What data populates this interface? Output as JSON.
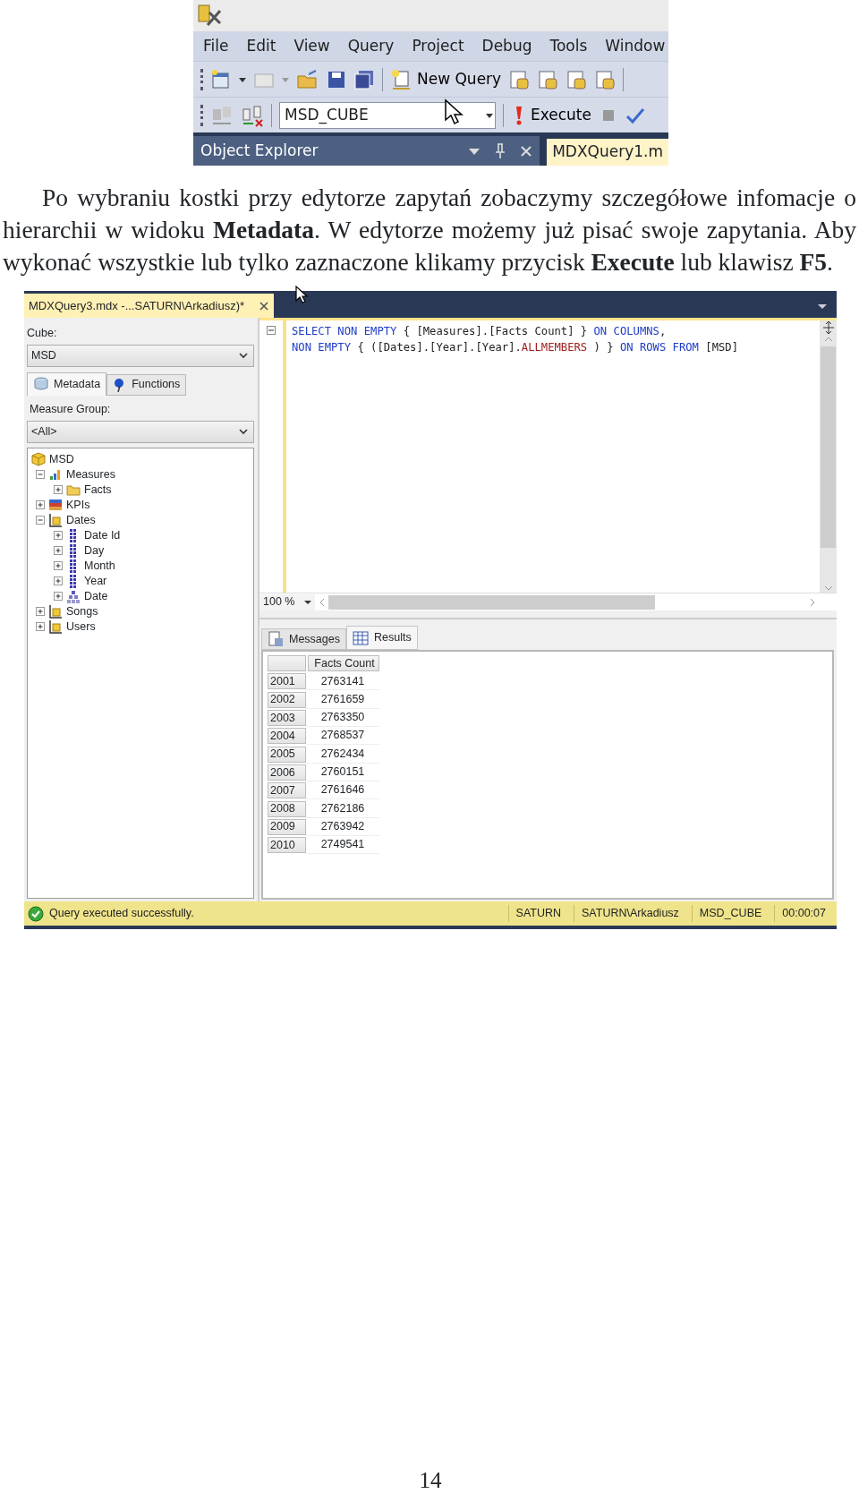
{
  "toolbar_screenshot": {
    "menu": [
      "File",
      "Edit",
      "View",
      "Query",
      "Project",
      "Debug",
      "Tools",
      "Window"
    ],
    "new_query": "New Query",
    "database": {
      "value": "MSD_CUBE"
    },
    "execute": "Execute",
    "panel_title": "Object Explorer",
    "document_tab": "MDXQuery1.m"
  },
  "paragraph": "Po wybraniu kostki przy edytorze zapytań zobaczymy szczegółowe infomacje o hierarchii w widoku **Metadata**. W edytorze możemy już pisać swoje zapytania. Aby wykonać wszystkie lub tylko zaznaczone klikamy przycisk **Execute** lub klawisz **F5**.",
  "query_screenshot": {
    "document_tab": "MDXQuery3.mdx -...SATURN\\Arkadiusz)*",
    "cube_label": "Cube:",
    "cube": "MSD",
    "tabs": [
      {
        "label": "Metadata",
        "selected": true
      },
      {
        "label": "Functions",
        "selected": false
      }
    ],
    "measure_group_label": "Measure Group:",
    "measure_group": "<All>",
    "tree": [
      {
        "label": "MSD",
        "kind": "cube",
        "children": [
          {
            "label": "Measures",
            "kind": "measures",
            "expanded": true,
            "children": [
              {
                "label": "Facts",
                "kind": "folder",
                "expanded": false
              }
            ]
          },
          {
            "label": "KPIs",
            "kind": "kpi",
            "expanded": false
          },
          {
            "label": "Dates",
            "kind": "dimension",
            "expanded": true,
            "children": [
              {
                "label": "Date Id",
                "kind": "attribute",
                "expanded": false
              },
              {
                "label": "Day",
                "kind": "attribute",
                "expanded": false
              },
              {
                "label": "Month",
                "kind": "attribute",
                "expanded": false
              },
              {
                "label": "Year",
                "kind": "attribute",
                "expanded": false
              },
              {
                "label": "Date",
                "kind": "hierarchy",
                "expanded": false
              }
            ]
          },
          {
            "label": "Songs",
            "kind": "dimension",
            "expanded": false
          },
          {
            "label": "Users",
            "kind": "dimension",
            "expanded": false
          }
        ]
      }
    ],
    "code": [
      [
        {
          "text": "SELECT NON EMPTY",
          "kind": "keyword"
        },
        {
          "text": " { [Measures].[Facts Count] } ",
          "kind": "plain"
        },
        {
          "text": "ON COLUMNS",
          "kind": "keyword"
        },
        {
          "text": ",",
          "kind": "plain"
        }
      ],
      [
        {
          "text": "NON EMPTY",
          "kind": "keyword"
        },
        {
          "text": " { ([Dates].[Year].[Year].",
          "kind": "plain"
        },
        {
          "text": "ALLMEMBERS",
          "kind": "function"
        },
        {
          "text": " ) } ",
          "kind": "plain"
        },
        {
          "text": "ON ROWS FROM",
          "kind": "keyword"
        },
        {
          "text": " [MSD]",
          "kind": "plain"
        }
      ]
    ],
    "zoom": "100 %",
    "result_tabs": [
      {
        "label": "Messages",
        "selected": false
      },
      {
        "label": "Results",
        "selected": true
      }
    ],
    "grid": {
      "column": "Facts Count",
      "rows": [
        {
          "year": "2001",
          "value": "2763141"
        },
        {
          "year": "2002",
          "value": "2761659"
        },
        {
          "year": "2003",
          "value": "2763350"
        },
        {
          "year": "2004",
          "value": "2768537"
        },
        {
          "year": "2005",
          "value": "2762434"
        },
        {
          "year": "2006",
          "value": "2760151"
        },
        {
          "year": "2007",
          "value": "2761646"
        },
        {
          "year": "2008",
          "value": "2762186"
        },
        {
          "year": "2009",
          "value": "2763942"
        },
        {
          "year": "2010",
          "value": "2749541"
        }
      ]
    },
    "status": {
      "message": "Query executed successfully.",
      "fields": [
        "SATURN",
        "SATURN\\Arkadiusz",
        "MSD_CUBE",
        "00:00:07"
      ]
    }
  },
  "page_number": "14"
}
